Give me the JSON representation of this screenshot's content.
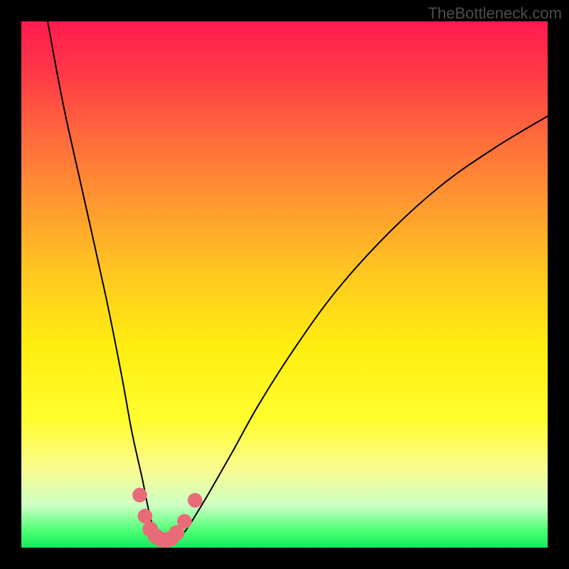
{
  "watermark": "TheBottleneck.com",
  "chart_data": {
    "type": "line",
    "title": "",
    "xlabel": "",
    "ylabel": "",
    "xlim": [
      0,
      100
    ],
    "ylim": [
      0,
      100
    ],
    "axes_visible": false,
    "grid": false,
    "background_gradient": {
      "stops": [
        {
          "pos": 0.0,
          "color": "#ff1a50"
        },
        {
          "pos": 0.1,
          "color": "#ff3a46"
        },
        {
          "pos": 0.22,
          "color": "#ff6a3c"
        },
        {
          "pos": 0.35,
          "color": "#ff9a30"
        },
        {
          "pos": 0.48,
          "color": "#ffc820"
        },
        {
          "pos": 0.62,
          "color": "#ffee10"
        },
        {
          "pos": 0.76,
          "color": "#fffd30"
        },
        {
          "pos": 0.85,
          "color": "#fafc90"
        },
        {
          "pos": 0.92,
          "color": "#ccffc4"
        },
        {
          "pos": 0.97,
          "color": "#48ff70"
        },
        {
          "pos": 1.0,
          "color": "#16e860"
        }
      ]
    },
    "series": [
      {
        "name": "bottleneck-curve",
        "x": [
          5,
          8,
          12,
          16,
          19,
          21,
          23,
          24,
          25,
          26,
          27,
          28,
          29,
          31,
          33,
          36,
          40,
          45,
          52,
          60,
          70,
          80,
          90,
          100
        ],
        "y": [
          100,
          84,
          66,
          48,
          33,
          22,
          13,
          8,
          4,
          2,
          1.5,
          1.2,
          1.5,
          3,
          6,
          11,
          18,
          27,
          38,
          49,
          60,
          69,
          76,
          82
        ]
      }
    ],
    "markers": [
      {
        "x": 22.5,
        "y": 10,
        "r": 1.0
      },
      {
        "x": 23.5,
        "y": 6,
        "r": 1.0
      },
      {
        "x": 24.5,
        "y": 3.5,
        "r": 1.1
      },
      {
        "x": 25.5,
        "y": 2.2,
        "r": 1.1
      },
      {
        "x": 26.5,
        "y": 1.6,
        "r": 1.1
      },
      {
        "x": 27.5,
        "y": 1.4,
        "r": 1.1
      },
      {
        "x": 28.5,
        "y": 1.8,
        "r": 1.1
      },
      {
        "x": 29.5,
        "y": 2.8,
        "r": 1.1
      },
      {
        "x": 31.0,
        "y": 5.0,
        "r": 1.0
      },
      {
        "x": 33.0,
        "y": 9.0,
        "r": 1.0
      }
    ],
    "marker_color": "#e86b78"
  }
}
